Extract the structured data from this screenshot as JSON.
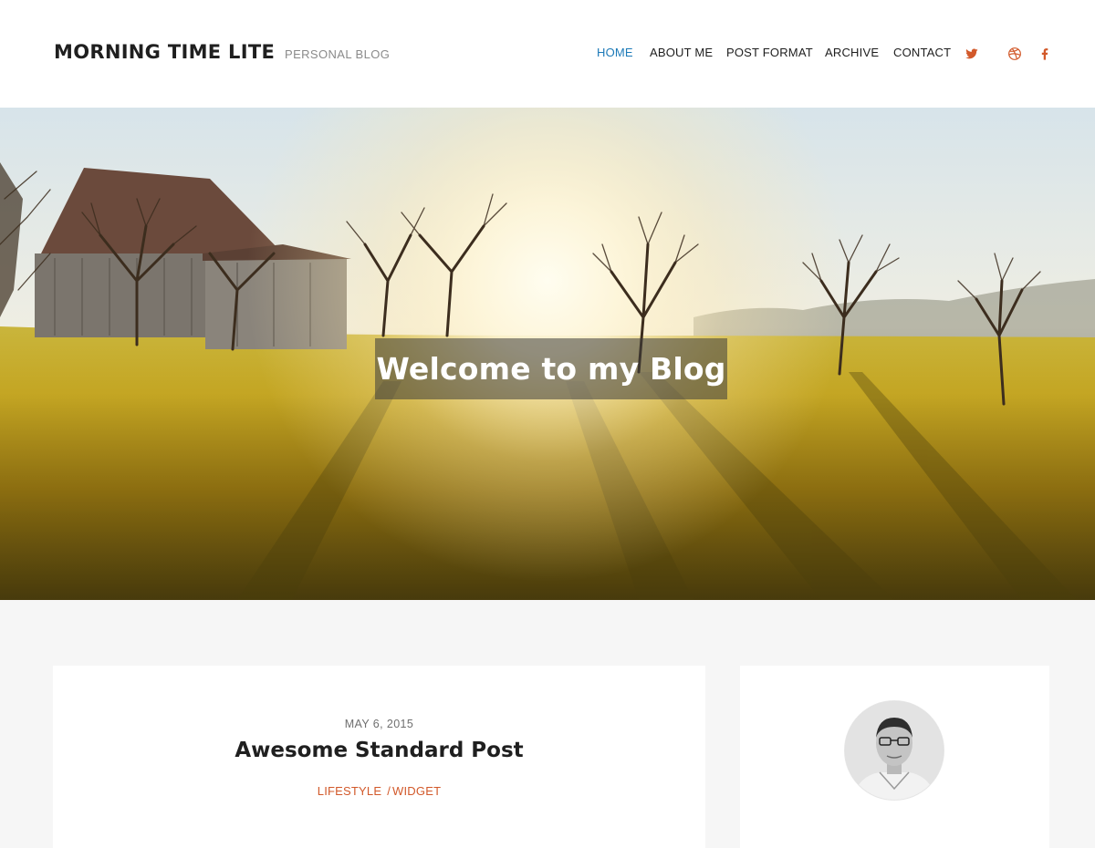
{
  "site": {
    "title": "MORNING TIME LITE",
    "tagline": "PERSONAL BLOG"
  },
  "nav": {
    "items": [
      {
        "label": "HOME",
        "active": true
      },
      {
        "label": "ABOUT ME",
        "active": false
      },
      {
        "label": "POST FORMAT",
        "active": false
      },
      {
        "label": "ARCHIVE",
        "active": false
      },
      {
        "label": "CONTACT",
        "active": false
      }
    ],
    "social": [
      "twitter-icon",
      "dribbble-icon",
      "facebook-icon"
    ]
  },
  "hero": {
    "title": "Welcome to my Blog"
  },
  "post": {
    "date": "MAY 6, 2015",
    "title": "Awesome Standard Post",
    "categories": [
      "LIFESTYLE",
      "WIDGET"
    ],
    "separator": "/"
  },
  "colors": {
    "accent": "#d2592a",
    "nav_active": "#1d7ab8",
    "text": "#1f1f1f",
    "background": "#f6f6f6"
  }
}
